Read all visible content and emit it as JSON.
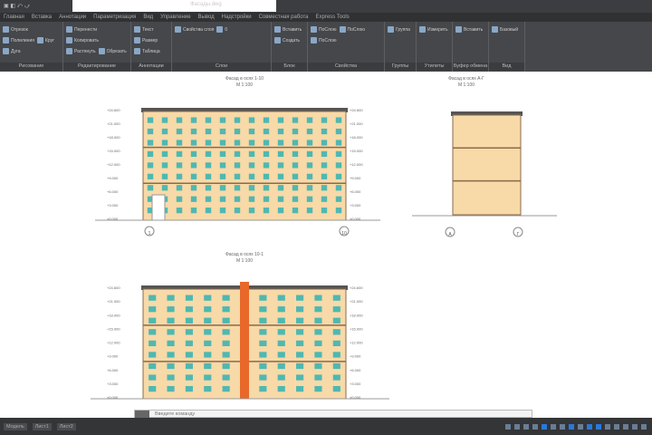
{
  "title": {
    "quick_access": "▣ ◧ ⤺ ⤻",
    "document": "Фасады.dwg"
  },
  "tabs": [
    "Главная",
    "Вставка",
    "Аннотации",
    "Параметризация",
    "Вид",
    "Управление",
    "Вывод",
    "Надстройки",
    "Совместная работа",
    "Express Tools"
  ],
  "panels": [
    {
      "label": "Рисование",
      "buttons": [
        "Отрезок",
        "Полилиния",
        "Круг",
        "Дуга"
      ]
    },
    {
      "label": "Редактирование",
      "buttons": [
        "Перенести",
        "Копировать",
        "Растянуть",
        "Обрезать"
      ]
    },
    {
      "label": "Аннотации",
      "buttons": [
        "Текст",
        "Размер",
        "Таблица"
      ]
    },
    {
      "label": "Слои",
      "buttons": [
        "Свойства слоя",
        "0"
      ]
    },
    {
      "label": "Блок",
      "buttons": [
        "Вставить",
        "Создать"
      ]
    },
    {
      "label": "Свойства",
      "buttons": [
        "ПоСлою",
        "ПоСлою",
        "ПоСлою"
      ]
    },
    {
      "label": "Группы",
      "buttons": [
        "Группа"
      ]
    },
    {
      "label": "Утилиты",
      "buttons": [
        "Измерить"
      ]
    },
    {
      "label": "Буфер обмена",
      "buttons": [
        "Вставить"
      ]
    },
    {
      "label": "Вид",
      "buttons": [
        "Базовый"
      ]
    }
  ],
  "drawings": {
    "elev1": {
      "title": "Фасад в осях 1-10",
      "scale": "М 1:100",
      "axis_left": "1",
      "axis_right": "10"
    },
    "elev2": {
      "title": "Фасад в осях А-Г",
      "scale": "М 1:100",
      "axis_left": "А",
      "axis_right": "Г"
    },
    "elev3": {
      "title": "Фасад в осях 10-1",
      "scale": "М 1:100"
    },
    "levels": [
      "+24.600",
      "+21.000",
      "+18.000",
      "+15.000",
      "+12.000",
      "+9.000",
      "+6.000",
      "+3.000",
      "±0.000"
    ]
  },
  "command": {
    "placeholder": "Введите команду"
  },
  "status": {
    "tabs": [
      "Модель",
      "Лист1",
      "Лист2"
    ]
  },
  "colors": {
    "facade": "#f8d9a8",
    "window": "#4fb8b0",
    "accent": "#e8682a",
    "frame": "#8b6a4a"
  }
}
